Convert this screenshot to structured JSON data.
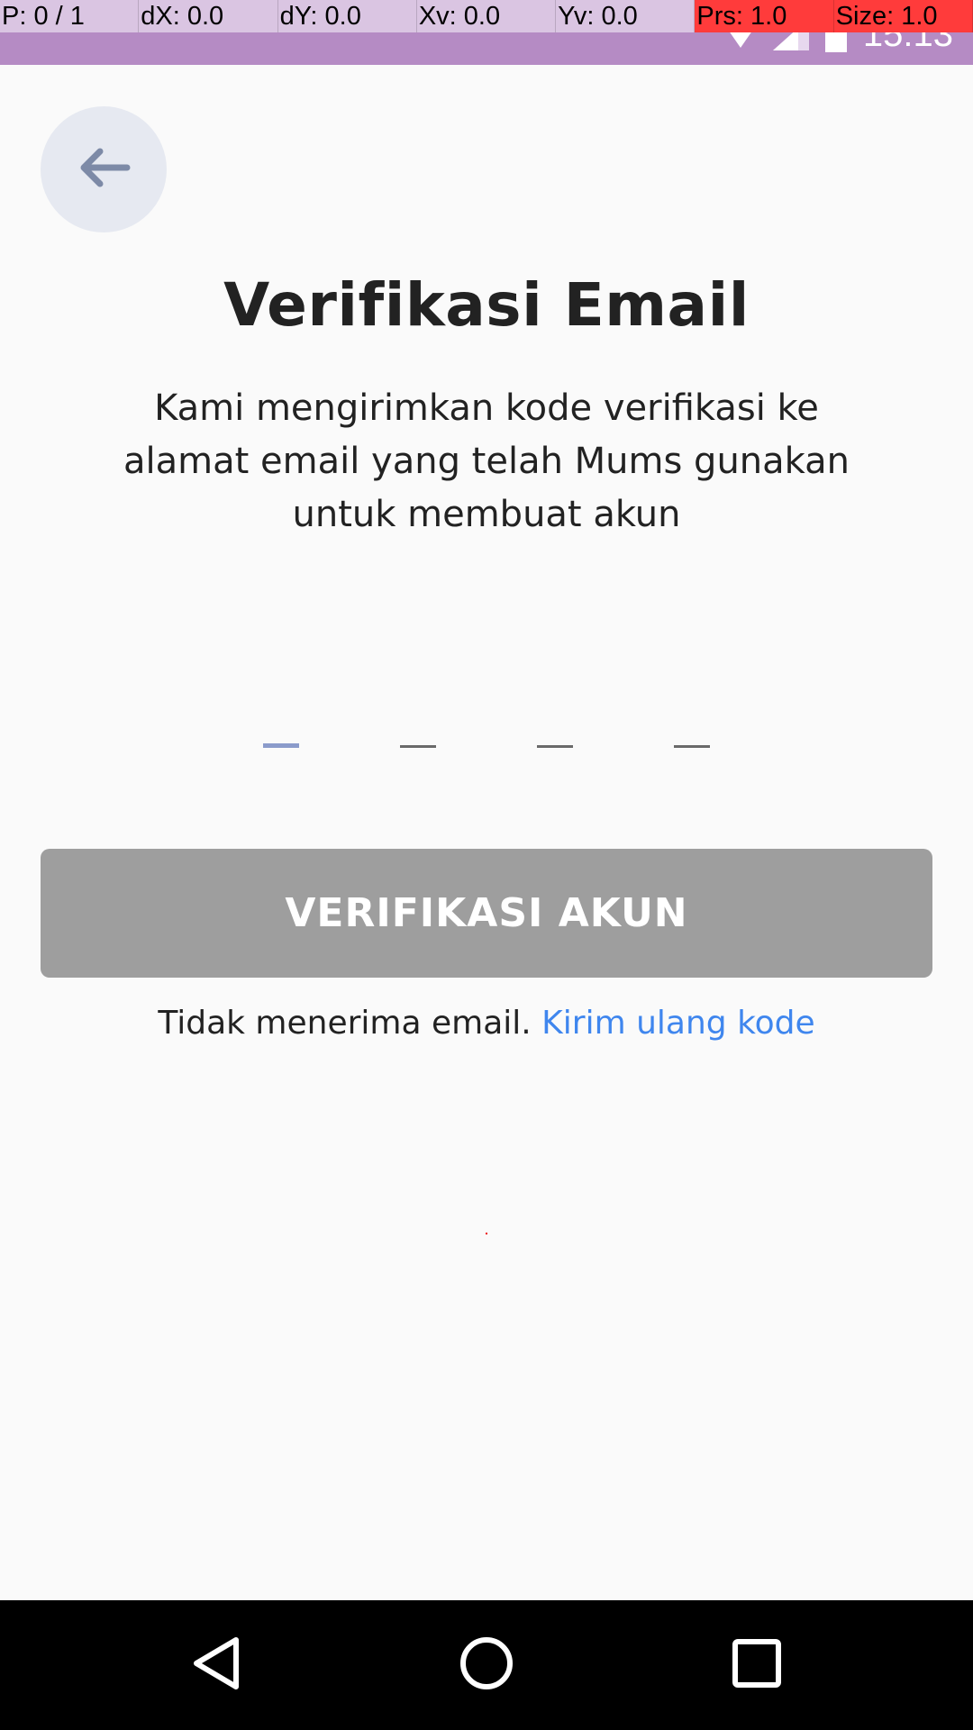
{
  "pointer_overlay": {
    "p": "P: 0 / 1",
    "dx": "dX: 0.0",
    "dy": "dY: 0.0",
    "xv": "Xv: 0.0",
    "yv": "Yv: 0.0",
    "prs": "Prs: 1.0",
    "size": "Size: 1.0"
  },
  "status_bar": {
    "time": "15:13",
    "icons": [
      "wifi-icon",
      "signal-icon",
      "battery-icon"
    ]
  },
  "header": {
    "back_icon": "arrow-left-icon"
  },
  "main": {
    "title": "Verifikasi Email",
    "subtitle": "Kami mengirimkan kode verifikasi ke alamat email yang telah Mums gunakan untuk membuat akun",
    "otp_digits": [
      "",
      "",
      "",
      ""
    ],
    "verify_button_label": "VERIFIKASI AKUN",
    "resend_prefix": "Tidak menerima email.",
    "resend_link": "Kirim ulang kode"
  },
  "nav_bar": {
    "icons": [
      "back-triangle-icon",
      "home-circle-icon",
      "recents-square-icon"
    ]
  },
  "colors": {
    "status_bar": "#b58bc4",
    "back_button_bg": "#e6e9f1",
    "otp_active": "#8b9bcb",
    "button_disabled": "#9e9e9e",
    "link": "#3f86ee"
  }
}
